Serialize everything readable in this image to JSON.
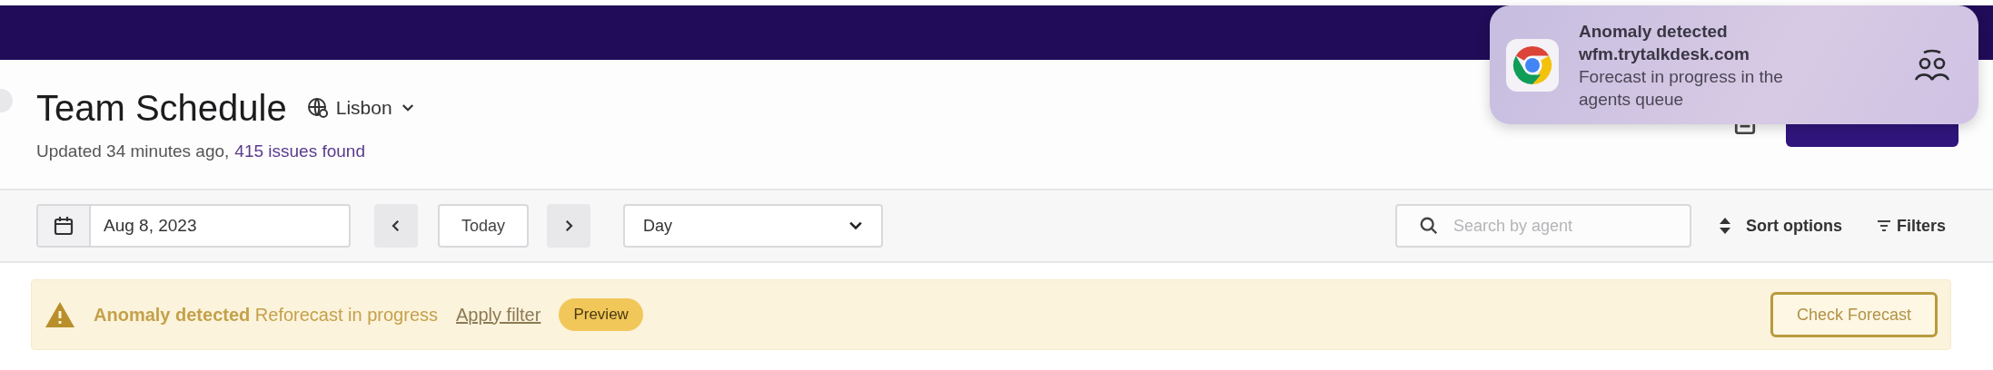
{
  "header": {
    "title": "Team Schedule",
    "location": "Lisbon",
    "updated": "Updated 34 minutes ago,",
    "issues": "415 issues found"
  },
  "toolbar": {
    "date": "Aug 8, 2023",
    "today": "Today",
    "view": "Day",
    "search": {
      "placeholder": "Search by agent"
    },
    "sort": "Sort options",
    "filters": "Filters"
  },
  "banner": {
    "title": "Anomaly detected",
    "message": "Reforecast in progress",
    "link": "Apply filter",
    "badge": "Preview",
    "action": "Check Forecast"
  },
  "notification": {
    "title": "Anomaly detected",
    "source": "wfm.trytalkdesk.com",
    "body": "Forecast in progress in the agents queue"
  }
}
